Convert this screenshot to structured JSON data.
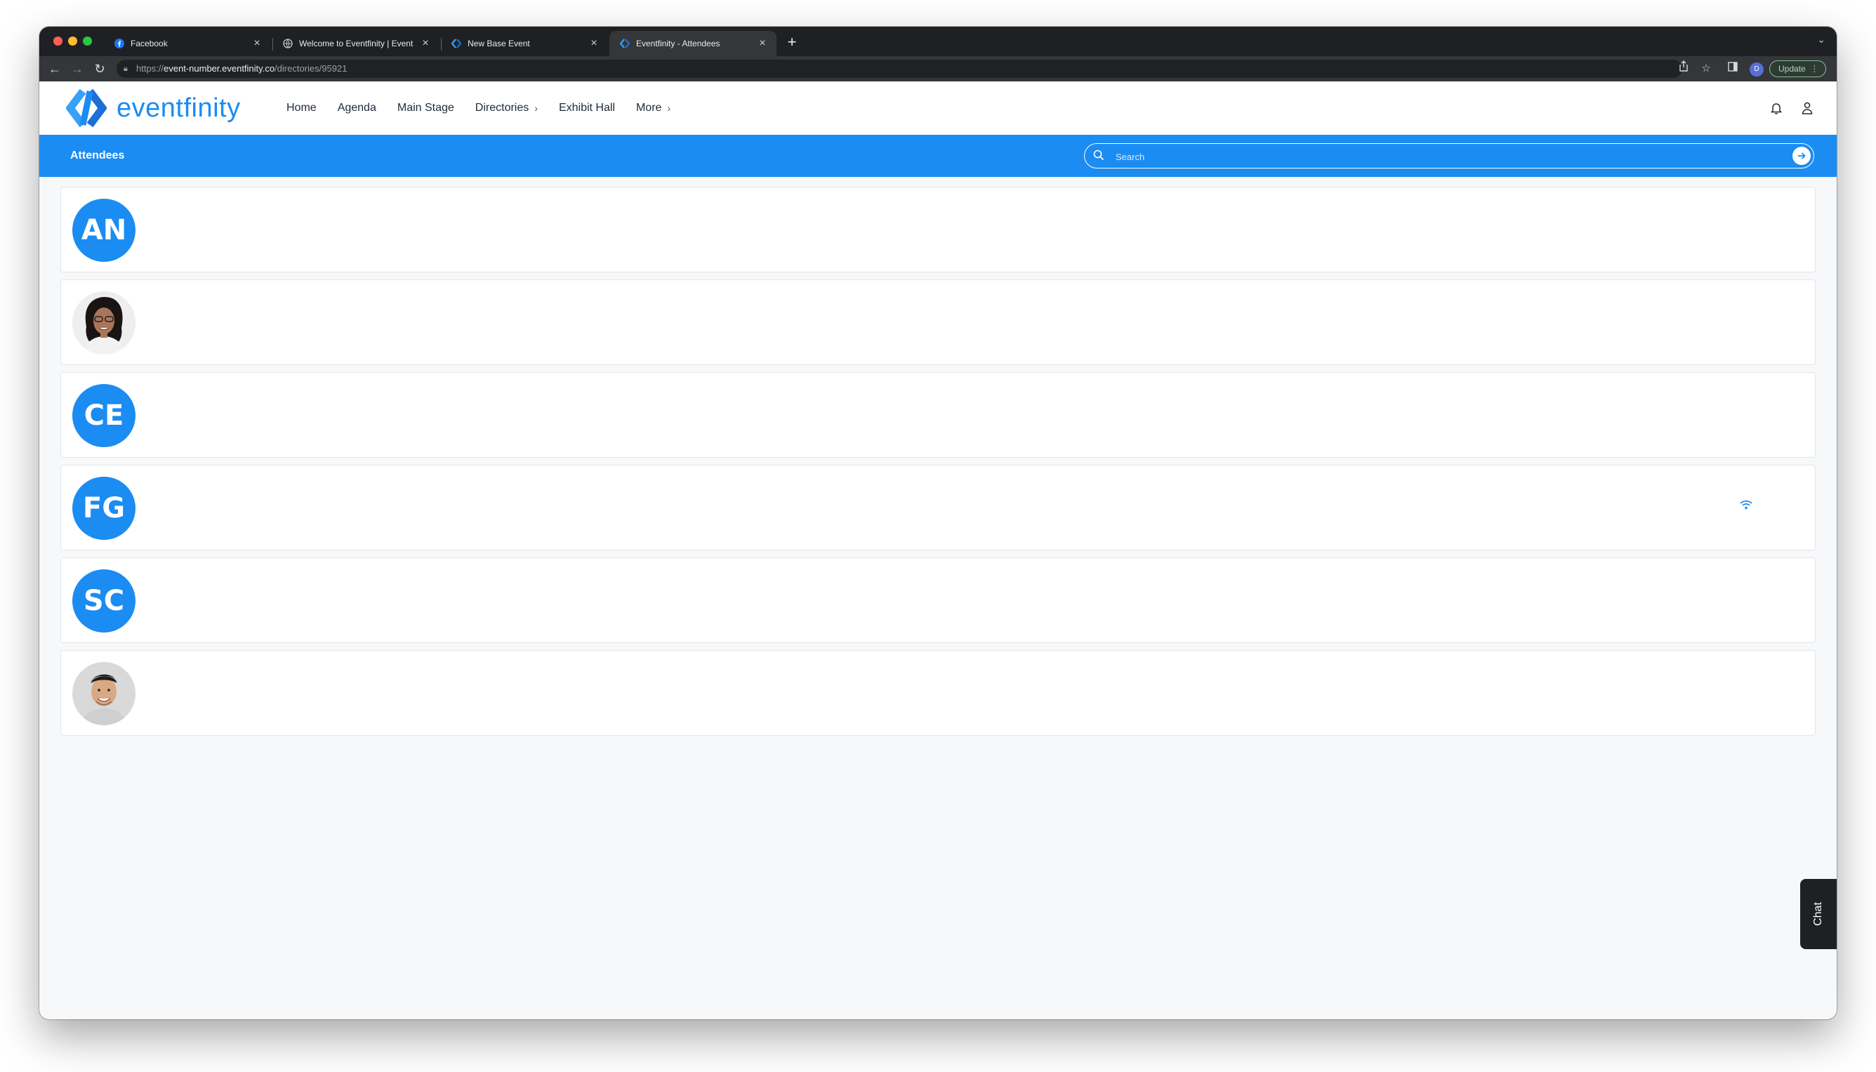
{
  "browser": {
    "tabs": [
      {
        "title": "Facebook",
        "icon": "facebook-icon",
        "active": false
      },
      {
        "title": "Welcome to Eventfinity | Event",
        "icon": "globe-icon",
        "active": false
      },
      {
        "title": "New Base Event",
        "icon": "eventfinity-icon",
        "active": false
      },
      {
        "title": "Eventfinity - Attendees",
        "icon": "eventfinity-icon",
        "active": true
      }
    ],
    "url_scheme": "https://",
    "url_host": "event-number.eventfinity.co",
    "url_path": "/directories/95921",
    "profile_initial": "D",
    "update_label": "Update"
  },
  "site": {
    "logo_text": "eventfinity",
    "nav": [
      {
        "label": "Home",
        "has_chevron": false
      },
      {
        "label": "Agenda",
        "has_chevron": false
      },
      {
        "label": "Main Stage",
        "has_chevron": false
      },
      {
        "label": "Directories",
        "has_chevron": true
      },
      {
        "label": "Exhibit Hall",
        "has_chevron": false
      },
      {
        "label": "More",
        "has_chevron": true
      }
    ],
    "brand_color": "#1b8cf2"
  },
  "attendees_bar": {
    "title": "Attendees",
    "search_placeholder": "Search"
  },
  "attendees": [
    {
      "initials": "AN",
      "photo": false
    },
    {
      "initials": "",
      "photo": true,
      "photo_icon": "woman-avatar"
    },
    {
      "initials": "CE",
      "photo": false
    },
    {
      "initials": "FG",
      "photo": false,
      "status_icon": "wifi-icon"
    },
    {
      "initials": "SC",
      "photo": false
    },
    {
      "initials": "",
      "photo": true,
      "photo_icon": "man-avatar"
    }
  ],
  "chat": {
    "label": "Chat"
  }
}
